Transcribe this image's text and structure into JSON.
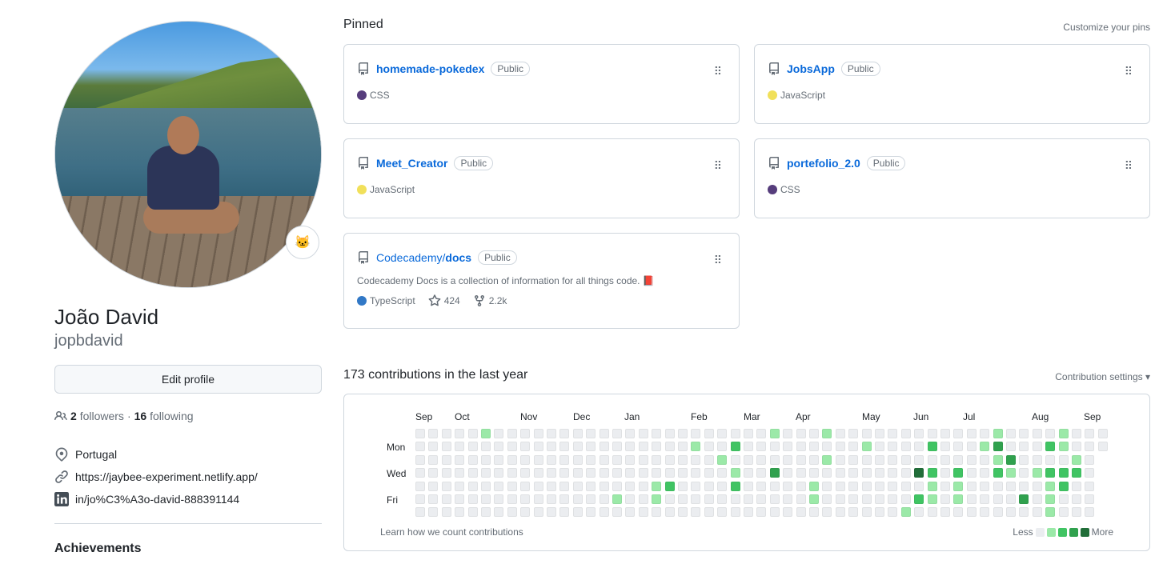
{
  "profile": {
    "fullname": "João David",
    "username": "jopbdavid",
    "status_emoji": "🐱",
    "edit_label": "Edit profile",
    "followers_count": "2",
    "followers_label": "followers",
    "separator": "·",
    "following_count": "16",
    "following_label": "following",
    "location": "Portugal",
    "website": "https://jaybee-experiment.netlify.app/",
    "linkedin": "in/jo%C3%A3o-david-888391144",
    "achievements_label": "Achievements"
  },
  "pinned": {
    "title": "Pinned",
    "customize_label": "Customize your pins",
    "repos": [
      {
        "name": "homemade-pokedex",
        "owner": "",
        "visibility": "Public",
        "language": "CSS",
        "language_color": "#563d7c",
        "description": "",
        "stars": "",
        "forks": ""
      },
      {
        "name": "JobsApp",
        "owner": "",
        "visibility": "Public",
        "language": "JavaScript",
        "language_color": "#f1e05a",
        "description": "",
        "stars": "",
        "forks": ""
      },
      {
        "name": "Meet_Creator",
        "owner": "",
        "visibility": "Public",
        "language": "JavaScript",
        "language_color": "#f1e05a",
        "description": "",
        "stars": "",
        "forks": ""
      },
      {
        "name": "portefolio_2.0",
        "owner": "",
        "visibility": "Public",
        "language": "CSS",
        "language_color": "#563d7c",
        "description": "",
        "stars": "",
        "forks": ""
      },
      {
        "name": "docs",
        "owner": "Codecademy/",
        "visibility": "Public",
        "language": "TypeScript",
        "language_color": "#3178c6",
        "description": "Codecademy Docs is a collection of information for all things code. 📕",
        "stars": "424",
        "forks": "2.2k"
      }
    ]
  },
  "contributions": {
    "title": "173 contributions in the last year",
    "settings_label": "Contribution settings ▾",
    "months": [
      "Sep",
      "Oct",
      "Nov",
      "Dec",
      "Jan",
      "Feb",
      "Mar",
      "Apr",
      "May",
      "Jun",
      "Jul",
      "Aug",
      "Sep"
    ],
    "day_labels": [
      "Mon",
      "Wed",
      "Fri"
    ],
    "learn_label": "Learn how we count contributions",
    "legend_less": "Less",
    "legend_more": "More",
    "colors": [
      "#ebedf0",
      "#9be9a8",
      "#40c463",
      "#30a14e",
      "#216e39"
    ]
  }
}
